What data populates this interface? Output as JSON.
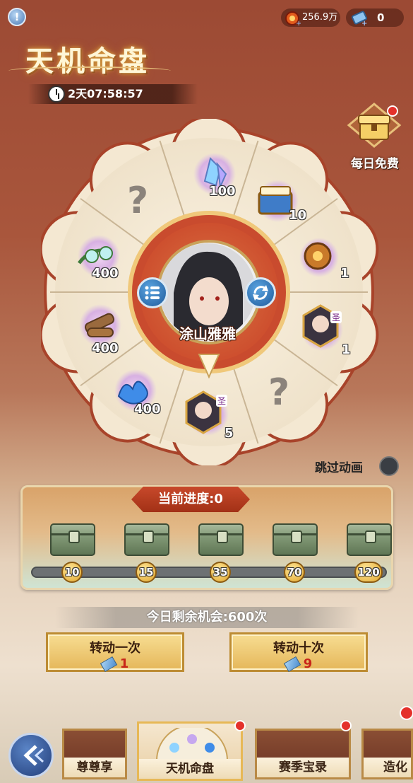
{
  "header": {
    "currency_1": "256.9万",
    "currency_2": "0",
    "title": "天机命盘",
    "timer": "2天07:58:57"
  },
  "daily_free": {
    "label": "每日免费"
  },
  "wheel": {
    "center_name": "涂山雅雅",
    "slots": [
      {
        "item": "crystal",
        "count": "100"
      },
      {
        "item": "treasure-chest",
        "count": "10"
      },
      {
        "item": "compass",
        "count": "1"
      },
      {
        "item": "character-card",
        "badge": "圣",
        "count": "1"
      },
      {
        "item": "unknown",
        "text": "?"
      },
      {
        "item": "character-card",
        "badge": "圣",
        "count": "5"
      },
      {
        "item": "blue-flame",
        "count": "400"
      },
      {
        "item": "wood",
        "count": "400"
      },
      {
        "item": "leaf-orbs",
        "count": "400"
      },
      {
        "item": "unknown",
        "text": "?"
      }
    ]
  },
  "skip_animation": {
    "label": "跳过动画"
  },
  "progress": {
    "label": "当前进度:0",
    "milestones": [
      "10",
      "15",
      "35",
      "70",
      "120"
    ]
  },
  "remaining": {
    "label": "今日剩余机会:600次"
  },
  "spin_once": {
    "label": "转动一次",
    "cost": "1"
  },
  "spin_ten": {
    "label": "转动十次",
    "cost": "9"
  },
  "tabs": [
    "尊尊享",
    "天机命盘",
    "赛季宝录",
    "造化宝"
  ],
  "colors": {
    "accent": "#c8492b",
    "badge_red": "#e4312b"
  }
}
